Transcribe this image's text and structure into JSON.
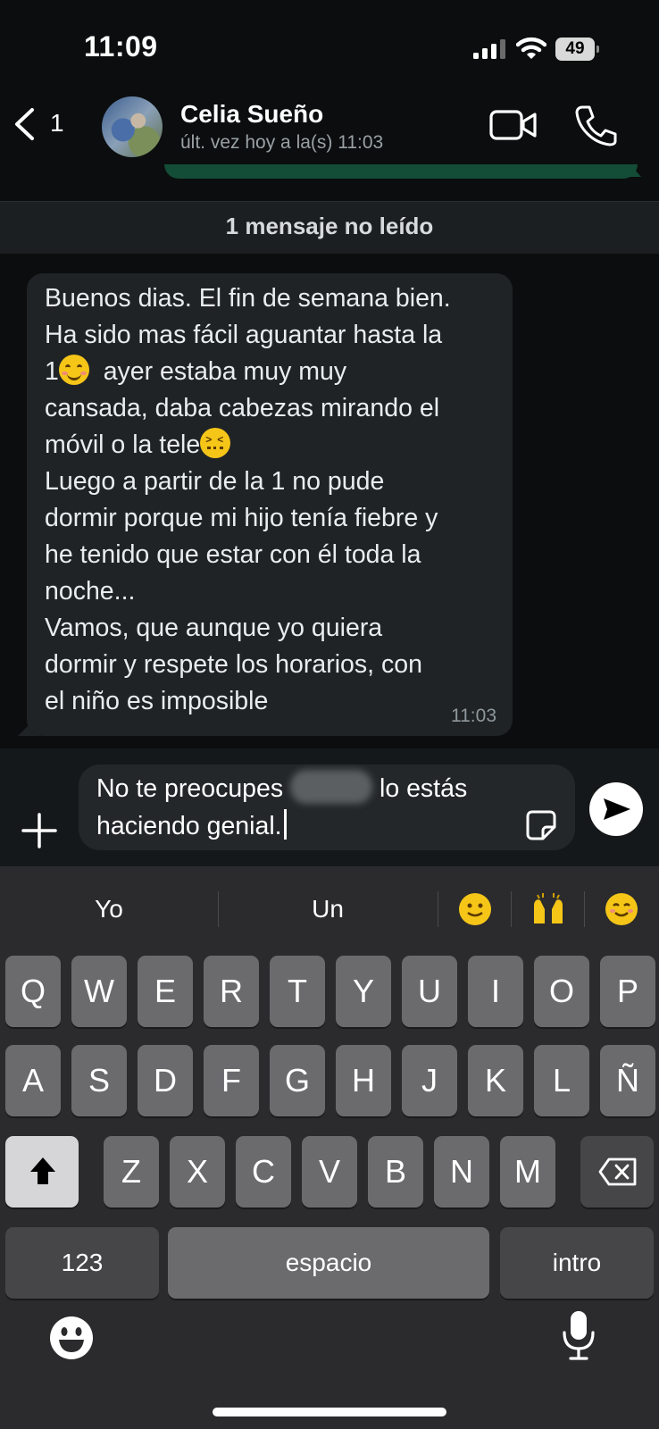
{
  "status_bar": {
    "time": "11:09",
    "battery": "49"
  },
  "header": {
    "back_count": "1",
    "contact_name": "Celia Sueño",
    "last_seen": "últ. vez hoy a la(s) 11:03"
  },
  "unread_banner": "1 mensaje no leído",
  "message": {
    "lines": [
      "Buenos dias. El fin de semana bien.",
      "Ha sido mas fácil aguantar hasta la",
      "1",
      "  ayer estaba muy muy",
      "cansada, daba cabezas mirando el",
      "móvil o la tele",
      "Luego a partir de la 1 no pude",
      "dormir porque mi hijo tenía fiebre y",
      "he tenido que estar con él toda la",
      "noche...",
      "Vamos, que aunque yo quiera",
      "dormir y respete los horarios, con",
      "el niño es imposible"
    ],
    "time": "11:03"
  },
  "composer": {
    "draft_part1": "No te preocupes",
    "draft_part2": "lo estás",
    "draft_part3": "haciendo genial."
  },
  "keyboard": {
    "suggestions": [
      "Yo",
      "Un"
    ],
    "emoji_suggestions": [
      "slightly-smiling-face",
      "raising-hands",
      "smiling-face"
    ],
    "row1": [
      "Q",
      "W",
      "E",
      "R",
      "T",
      "Y",
      "U",
      "I",
      "O",
      "P"
    ],
    "row2": [
      "A",
      "S",
      "D",
      "F",
      "G",
      "H",
      "J",
      "K",
      "L",
      "Ñ"
    ],
    "row3": [
      "Z",
      "X",
      "C",
      "V",
      "B",
      "N",
      "M"
    ],
    "numbers_label": "123",
    "space_label": "espacio",
    "return_label": "intro"
  }
}
